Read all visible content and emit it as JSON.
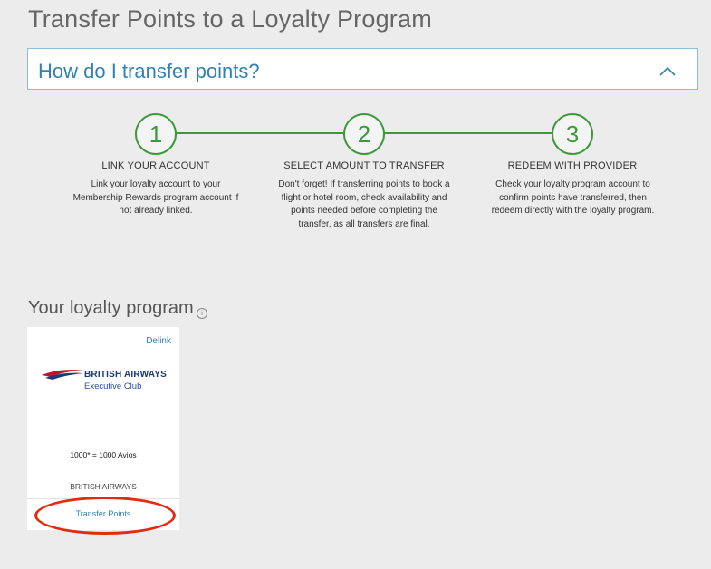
{
  "page": {
    "title": "Transfer Points to a Loyalty Program"
  },
  "accordion": {
    "title": "How do I transfer points?",
    "icon": "chevron-up-icon"
  },
  "steps": [
    {
      "number": "1",
      "title": "LINK YOUR ACCOUNT",
      "description": "Link your loyalty account to your Membership Rewards program account if not already linked."
    },
    {
      "number": "2",
      "title": "SELECT AMOUNT TO TRANSFER",
      "description": "Don't forget! If transferring points to book a flight or hotel room, check availability and points needed before completing the transfer, as all transfers are final."
    },
    {
      "number": "3",
      "title": "REDEEM WITH PROVIDER",
      "description": "Check your loyalty program account to confirm points have transferred, then redeem directly with the loyalty program."
    }
  ],
  "loyalty": {
    "section_title": "Your loyalty program",
    "info_icon": "ⓘ",
    "card": {
      "delink_label": "Delink",
      "logo_name": "BRITISH AIRWAYS",
      "logo_subtitle": "Executive Club",
      "ratio": "1000* = 1000 Avios",
      "program_name": "BRITISH AIRWAYS",
      "transfer_label": "Transfer Points"
    }
  },
  "colors": {
    "accent_blue": "#2f82b5",
    "step_green": "#3a9a3a",
    "highlight_red": "#e52a12",
    "background": "#ececec"
  }
}
